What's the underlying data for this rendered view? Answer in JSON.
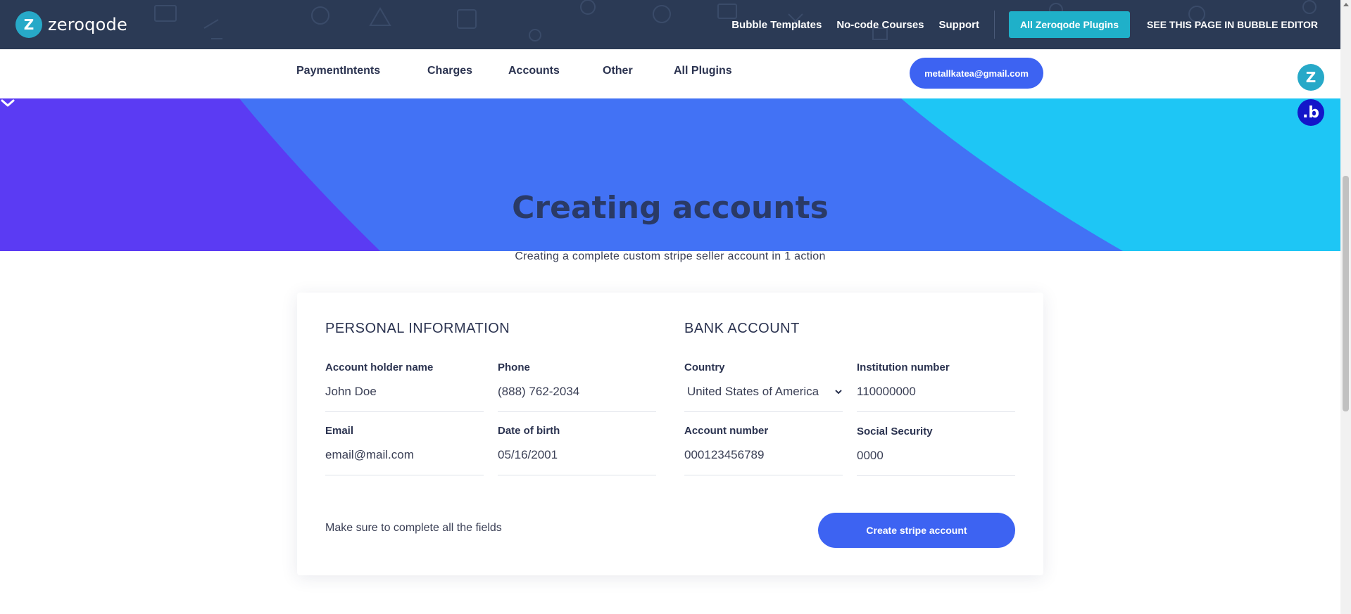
{
  "header": {
    "logo_text": "zeroqode",
    "logo_mark": "Z",
    "links": [
      "Bubble Templates",
      "No-code Courses",
      "Support"
    ],
    "cta": "All Zeroqode Plugins",
    "editor_link": "SEE THIS PAGE IN BUBBLE EDITOR"
  },
  "subnav": {
    "items": [
      "PaymentIntents",
      "Charges",
      "Accounts",
      "Other",
      "All Plugins"
    ],
    "user_email": "metallkatea@gmail.com"
  },
  "hero": {
    "title": "Creating accounts",
    "subtitle": "Creating a complete custom stripe seller account in 1 action",
    "colors": {
      "left": "#5b3bf3",
      "center": "#4272f5",
      "right": "#1ec6f5"
    }
  },
  "form": {
    "personal_title": "PERSONAL INFORMATION",
    "bank_title": "BANK ACCOUNT",
    "fields": {
      "holder": {
        "label": "Account holder name",
        "value": "John Doe"
      },
      "phone": {
        "label": "Phone",
        "value": "(888) 762-2034"
      },
      "email": {
        "label": "Email",
        "value": "email@mail.com"
      },
      "dob": {
        "label": "Date of birth",
        "value": "05/16/2001"
      },
      "country": {
        "label": "Country",
        "value": "United States of America"
      },
      "institution": {
        "label": "Institution number",
        "value": "110000000"
      },
      "account_number": {
        "label": "Account number",
        "value": "000123456789"
      },
      "ssn": {
        "label": "Social Security",
        "value": "0000"
      }
    },
    "hint": "Make sure to complete all the fields",
    "submit_label": "Create stripe account"
  },
  "floating": {
    "zeroqode_mark": "Z",
    "bubble_mark": ".b"
  }
}
